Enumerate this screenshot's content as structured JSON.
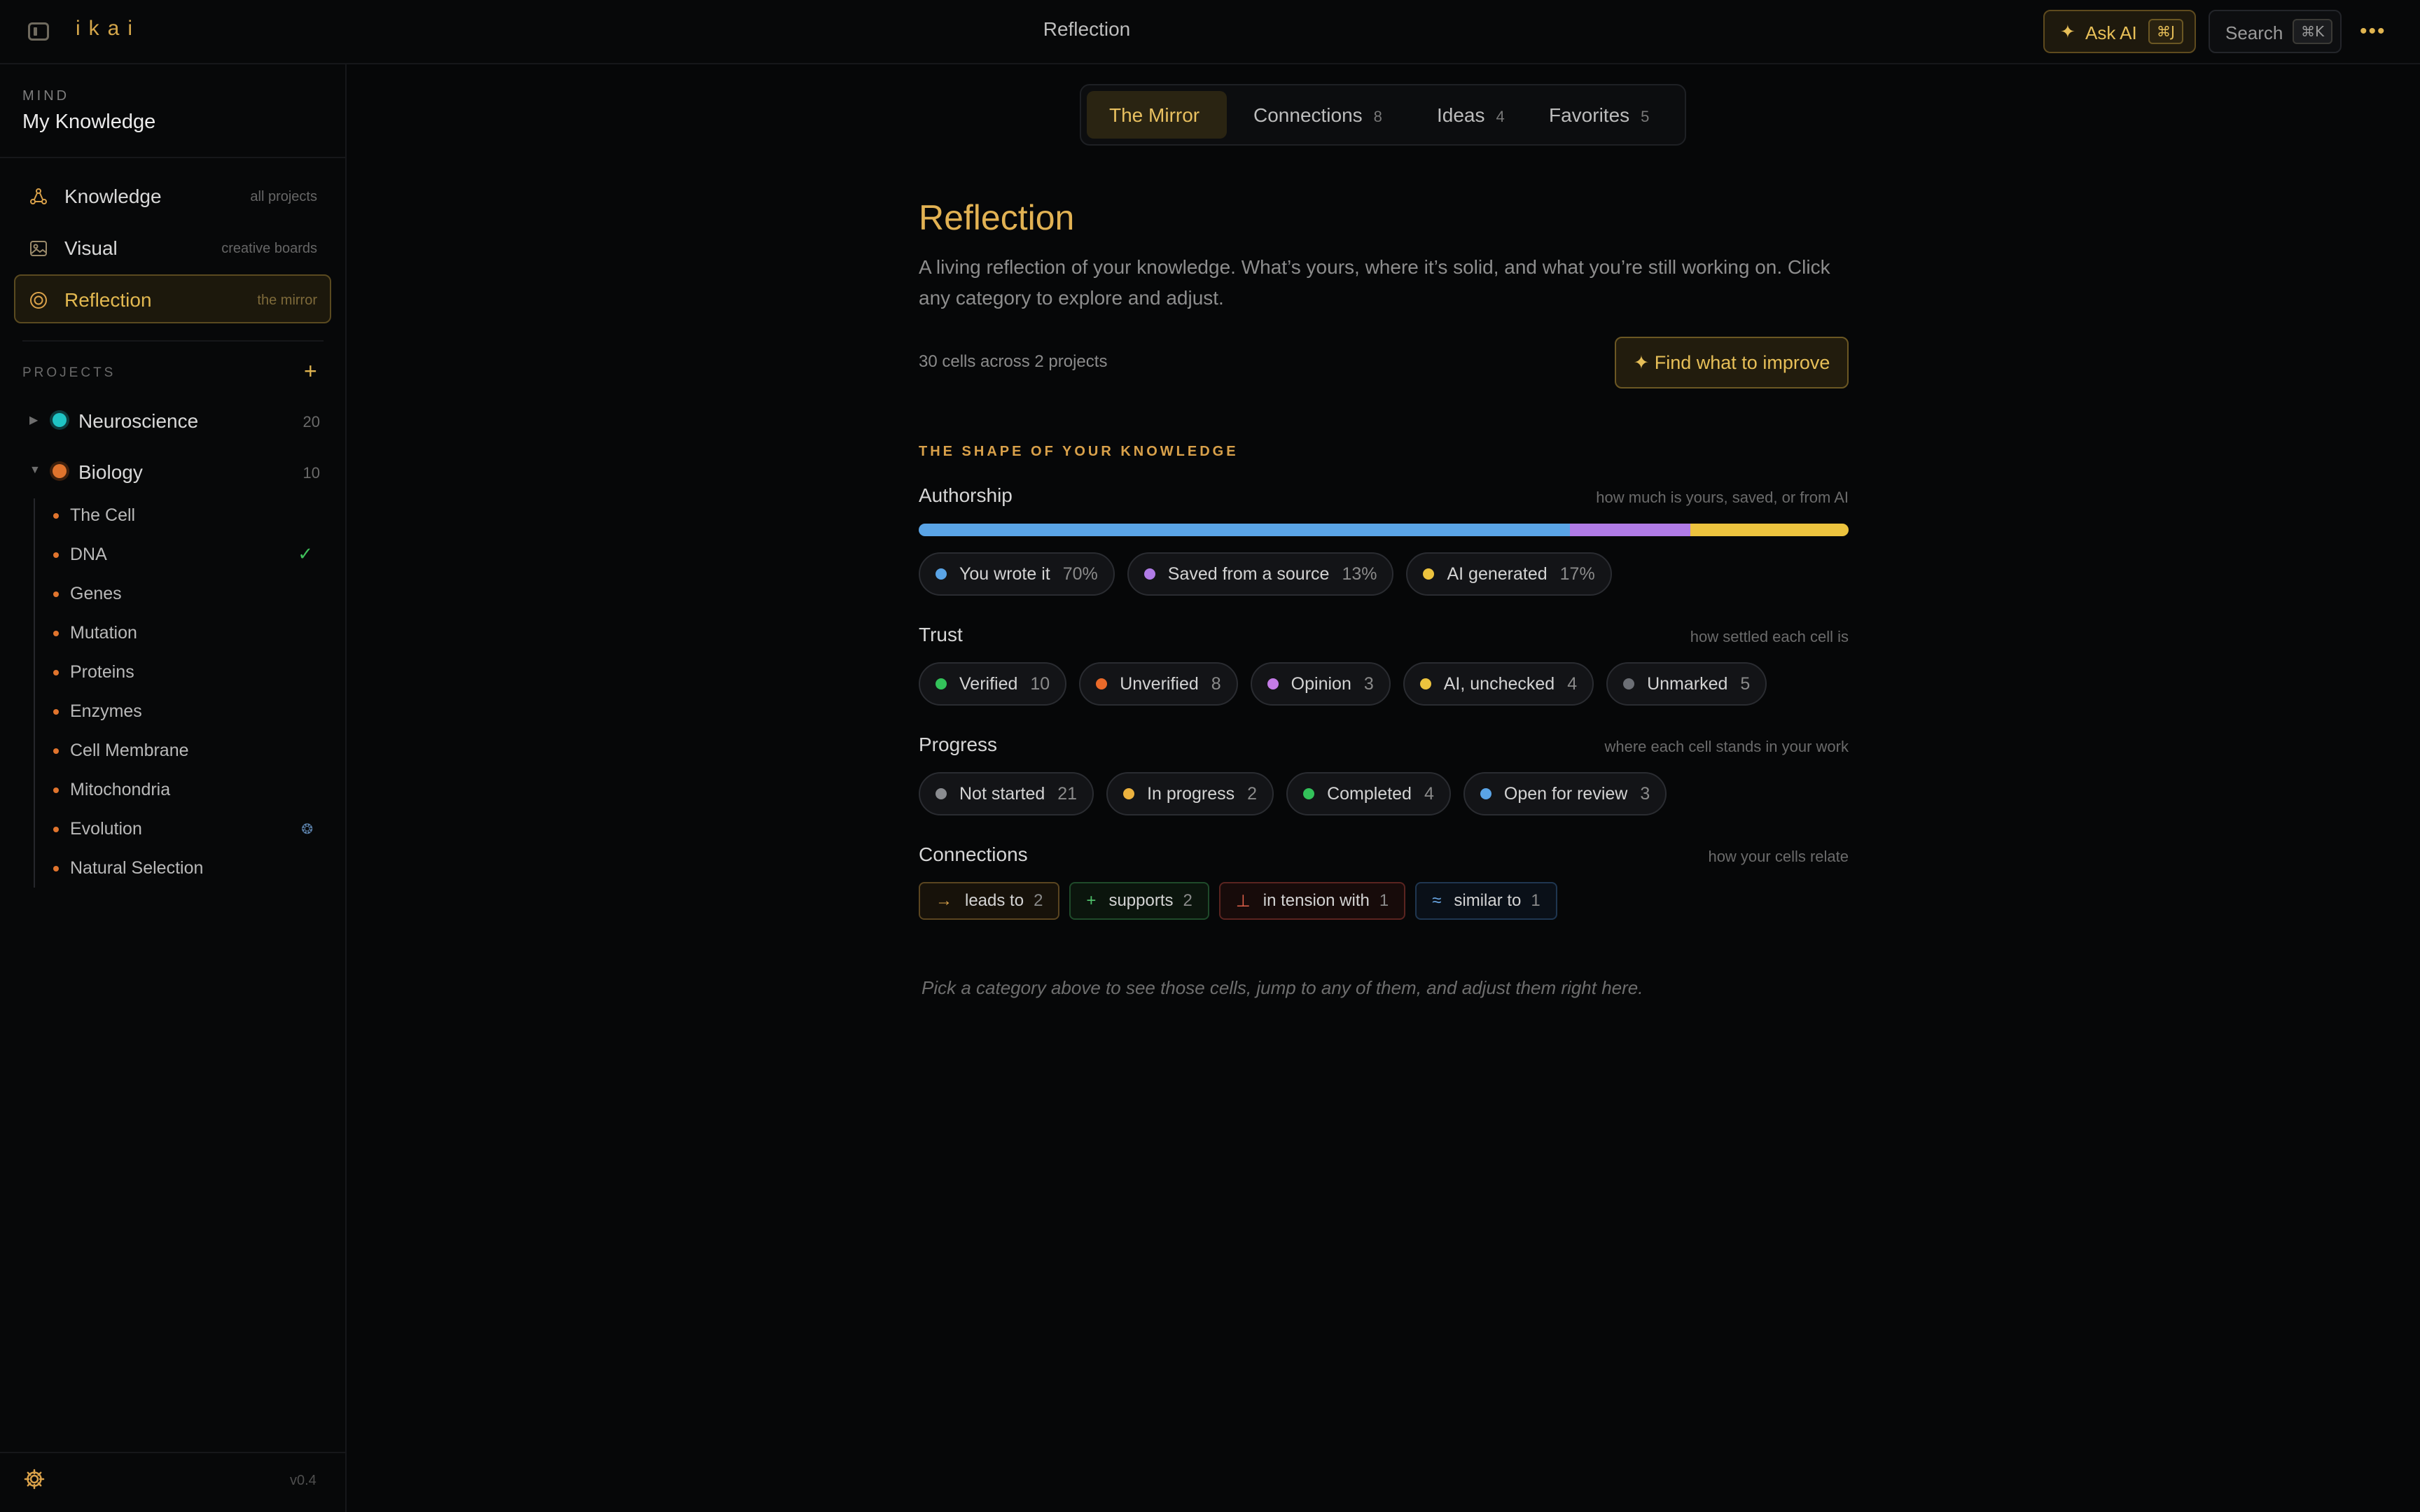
{
  "app": {
    "logo": "ikai",
    "page_title": "Reflection"
  },
  "topbar": {
    "ask_ai": {
      "icon": "sparkle-icon",
      "label": "Ask AI",
      "shortcut": "⌘J"
    },
    "search": {
      "label": "Search",
      "shortcut": "⌘K"
    },
    "more_icon": "more-dots-icon"
  },
  "sidebar": {
    "mind_label": "MIND",
    "mind_name": "My Knowledge",
    "nav": [
      {
        "label": "Knowledge",
        "hint": "all projects",
        "icon": "graph-nodes-icon",
        "active": false
      },
      {
        "label": "Visual",
        "hint": "creative boards",
        "icon": "image-icon",
        "active": false
      },
      {
        "label": "Reflection",
        "hint": "the mirror",
        "icon": "target-icon",
        "active": true
      }
    ],
    "projects_label": "PROJECTS",
    "add_symbol": "+",
    "projects": [
      {
        "name": "Neuroscience",
        "count": "20",
        "color": "#1fc4c4",
        "expanded": false,
        "caret": "▶"
      },
      {
        "name": "Biology",
        "count": "10",
        "color": "#e0742d",
        "expanded": true,
        "caret": "▼"
      }
    ],
    "cells": [
      {
        "name": "The Cell",
        "mark": ""
      },
      {
        "name": "DNA",
        "mark": "✓"
      },
      {
        "name": "Genes",
        "mark": ""
      },
      {
        "name": "Mutation",
        "mark": ""
      },
      {
        "name": "Proteins",
        "mark": ""
      },
      {
        "name": "Enzymes",
        "mark": ""
      },
      {
        "name": "Cell Membrane",
        "mark": ""
      },
      {
        "name": "Mitochondria",
        "mark": ""
      },
      {
        "name": "Evolution",
        "mark": "❂"
      },
      {
        "name": "Natural Selection",
        "mark": ""
      }
    ],
    "version": "v0.4"
  },
  "tabs": [
    {
      "label": "The Mirror",
      "count": "",
      "active": true
    },
    {
      "label": "Connections",
      "count": "8",
      "active": false
    },
    {
      "label": "Ideas",
      "count": "4",
      "active": false
    },
    {
      "label": "Favorites",
      "count": "5",
      "active": false
    }
  ],
  "main": {
    "title": "Reflection",
    "description": "A living reflection of your knowledge. What’s yours, where it’s solid, and what you’re still working on. Click any category to explore and adjust.",
    "cells_stat": "30 cells across 2 projects",
    "improve_button": "✦ Find what to improve",
    "section_kicker": "THE SHAPE OF YOUR KNOWLEDGE",
    "authorship": {
      "title": "Authorship",
      "hint": "how much is yours, saved, or from AI",
      "segments": [
        {
          "label": "You wrote it",
          "value": "70%",
          "fraction": 0.7,
          "color": "#5aa4e6"
        },
        {
          "label": "Saved from a source",
          "value": "13%",
          "fraction": 0.13,
          "color": "#b07be6"
        },
        {
          "label": "AI generated",
          "value": "17%",
          "fraction": 0.17,
          "color": "#ecc33e"
        }
      ]
    },
    "trust": {
      "title": "Trust",
      "hint": "how settled each cell is",
      "chips": [
        {
          "label": "Verified",
          "count": "10",
          "color": "#33c25a"
        },
        {
          "label": "Unverified",
          "count": "8",
          "color": "#ea6a2a"
        },
        {
          "label": "Opinion",
          "count": "3",
          "color": "#c47be6"
        },
        {
          "label": "AI, unchecked",
          "count": "4",
          "color": "#ecc33e"
        },
        {
          "label": "Unmarked",
          "count": "5",
          "color": "#6c6f75"
        }
      ]
    },
    "progress": {
      "title": "Progress",
      "hint": "where each cell stands in your work",
      "chips": [
        {
          "label": "Not started",
          "count": "21",
          "color": "#8a8c90"
        },
        {
          "label": "In progress",
          "count": "2",
          "color": "#ecb23e"
        },
        {
          "label": "Completed",
          "count": "4",
          "color": "#33c25a"
        },
        {
          "label": "Open for review",
          "count": "3",
          "color": "#5aa4e6"
        }
      ]
    },
    "connections": {
      "title": "Connections",
      "hint": "how your cells relate",
      "chips": [
        {
          "symbol": "→",
          "label": "leads to",
          "count": "2",
          "color": "#d9a14a",
          "border": "#5a4520",
          "bg": "#17120a"
        },
        {
          "symbol": "+",
          "label": "supports",
          "count": "2",
          "color": "#4fbf6a",
          "border": "#1f4a2a",
          "bg": "#0b150d"
        },
        {
          "symbol": "⊥",
          "label": "in tension with",
          "count": "1",
          "color": "#e0604a",
          "border": "#5a2420",
          "bg": "#170b0a"
        },
        {
          "symbol": "≈",
          "label": "similar to",
          "count": "1",
          "color": "#6aa8e6",
          "border": "#1f3650",
          "bg": "#0a1018"
        }
      ]
    },
    "footer_note": "Pick a category above to see those cells, jump to any of them, and adjust them right here."
  }
}
